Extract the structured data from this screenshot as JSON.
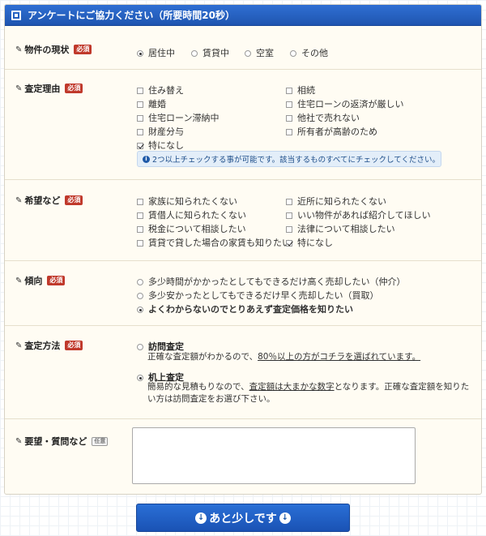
{
  "header": {
    "title": "アンケートにご協力ください（所要時間20秒）"
  },
  "required_label": "必須",
  "optional_label": "任意",
  "property_status": {
    "label": "物件の現状",
    "options": [
      "居住中",
      "賃貸中",
      "空室",
      "その他"
    ],
    "selected": "居住中"
  },
  "reason": {
    "label": "査定理由",
    "options": [
      "住み替え",
      "相続",
      "離婚",
      "住宅ローンの返済が厳しい",
      "住宅ローン滞納中",
      "他社で売れない",
      "財産分与",
      "所有者が高齢のため",
      "特になし"
    ],
    "checked": [
      "特になし"
    ],
    "info": "2つ以上チェックする事が可能です。該当するものすべてにチェックしてください。"
  },
  "wishes": {
    "label": "希望など",
    "options": [
      "家族に知られたくない",
      "近所に知られたくない",
      "賃借人に知られたくない",
      "いい物件があれば紹介してほしい",
      "税金について相談したい",
      "法律について相談したい",
      "賃貸で貸した場合の家賃も知りたい",
      "特になし"
    ],
    "checked": [
      "特になし"
    ]
  },
  "tendency": {
    "label": "傾向",
    "options": [
      "多少時間がかかったとしてもできるだけ高く売却したい（仲介）",
      "多少安かったとしてもできるだけ早く売却したい（買取）",
      "よくわからないのでとりあえず査定価格を知りたい"
    ],
    "selected": "よくわからないのでとりあえず査定価格を知りたい"
  },
  "method": {
    "label": "査定方法",
    "visit": {
      "title": "訪問査定",
      "desc_pre": "正確な査定額がわかるので、",
      "desc_link": "80％以上の方がコチラを選ばれています。"
    },
    "desk": {
      "title": "机上査定",
      "desc_pre": "簡易的な見積もりなので、",
      "desc_link": "査定額は大まかな数字",
      "desc_post": "となります。正確な査定額を知りたい方は訪問査定をお選び下さい。"
    },
    "selected": "机上査定"
  },
  "requests": {
    "label": "要望・質問など",
    "value": ""
  },
  "submit": {
    "label": "あと少しです"
  }
}
